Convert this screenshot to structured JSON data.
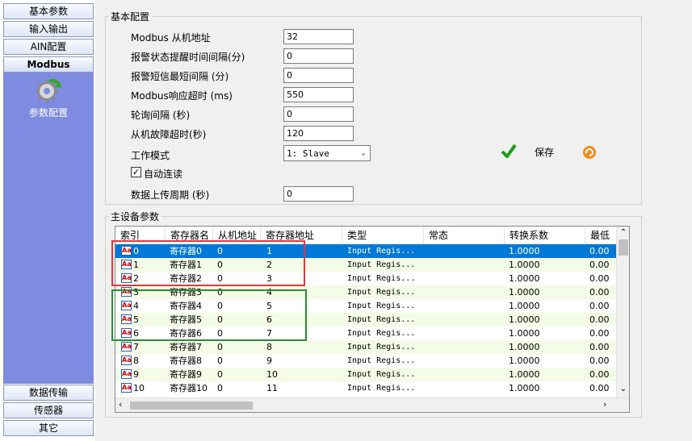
{
  "sidebar": {
    "top_items": [
      "基本参数",
      "输入输出",
      "AIN配置",
      "Modbus"
    ],
    "active_item": "参数配置",
    "bottom_items": [
      "数据传输",
      "传感器",
      "其它"
    ]
  },
  "basic_config": {
    "title": "基本配置",
    "fields": [
      {
        "label": "Modbus 从机地址",
        "value": "32"
      },
      {
        "label": "报警状态提醒时间间隔(分)",
        "value": "0"
      },
      {
        "label": "报警短信最短间隔 (分)",
        "value": "0"
      },
      {
        "label": "Modbus响应超时 (ms)",
        "value": "550"
      },
      {
        "label": "轮询间隔 (秒)",
        "value": "0"
      },
      {
        "label": "从机故障超时(秒)",
        "value": "120"
      }
    ],
    "work_mode_label": "工作模式",
    "work_mode_value": "1: Slave",
    "auto_read_label": "自动连读",
    "upload_period_label": "数据上传周期 (秒)",
    "upload_period_value": "0",
    "save_label": "保存"
  },
  "main_params": {
    "title": "主设备参数",
    "columns": [
      "索引",
      "寄存器名",
      "从机地址",
      "寄存器地址",
      "类型",
      "常态",
      "转换系数",
      "最低"
    ],
    "rows": [
      {
        "idx": "0",
        "name": "寄存器0",
        "slave": "0",
        "addr": "1",
        "type": "Input Regis...",
        "normal": "",
        "coef": "1.0000",
        "min": "0.00"
      },
      {
        "idx": "1",
        "name": "寄存器1",
        "slave": "0",
        "addr": "2",
        "type": "Input Regis...",
        "normal": "",
        "coef": "1.0000",
        "min": "0.00"
      },
      {
        "idx": "2",
        "name": "寄存器2",
        "slave": "0",
        "addr": "3",
        "type": "Input Regis...",
        "normal": "",
        "coef": "1.0000",
        "min": "0.00"
      },
      {
        "idx": "3",
        "name": "寄存器3",
        "slave": "0",
        "addr": "4",
        "type": "Input Regis...",
        "normal": "",
        "coef": "1.0000",
        "min": "0.00"
      },
      {
        "idx": "4",
        "name": "寄存器4",
        "slave": "0",
        "addr": "5",
        "type": "Input Regis...",
        "normal": "",
        "coef": "1.0000",
        "min": "0.00"
      },
      {
        "idx": "5",
        "name": "寄存器5",
        "slave": "0",
        "addr": "6",
        "type": "Input Regis...",
        "normal": "",
        "coef": "1.0000",
        "min": "0.00"
      },
      {
        "idx": "6",
        "name": "寄存器6",
        "slave": "0",
        "addr": "7",
        "type": "Input Regis...",
        "normal": "",
        "coef": "1.0000",
        "min": "0.00"
      },
      {
        "idx": "7",
        "name": "寄存器7",
        "slave": "0",
        "addr": "8",
        "type": "Input Regis...",
        "normal": "",
        "coef": "1.0000",
        "min": "0.00"
      },
      {
        "idx": "8",
        "name": "寄存器8",
        "slave": "0",
        "addr": "9",
        "type": "Input Regis...",
        "normal": "",
        "coef": "1.0000",
        "min": "0.00"
      },
      {
        "idx": "9",
        "name": "寄存器9",
        "slave": "0",
        "addr": "10",
        "type": "Input Regis...",
        "normal": "",
        "coef": "1.0000",
        "min": "0.00"
      },
      {
        "idx": "10",
        "name": "寄存器10",
        "slave": "0",
        "addr": "11",
        "type": "Input Regis...",
        "normal": "",
        "coef": "1.0000",
        "min": "0.00"
      }
    ]
  },
  "colors": {
    "selection": "#0078d7",
    "row_alt": "#f4fbe6",
    "nav_panel": "#7f8be0",
    "annotation_red": "#e0383c",
    "annotation_green": "#2e8b3a"
  }
}
